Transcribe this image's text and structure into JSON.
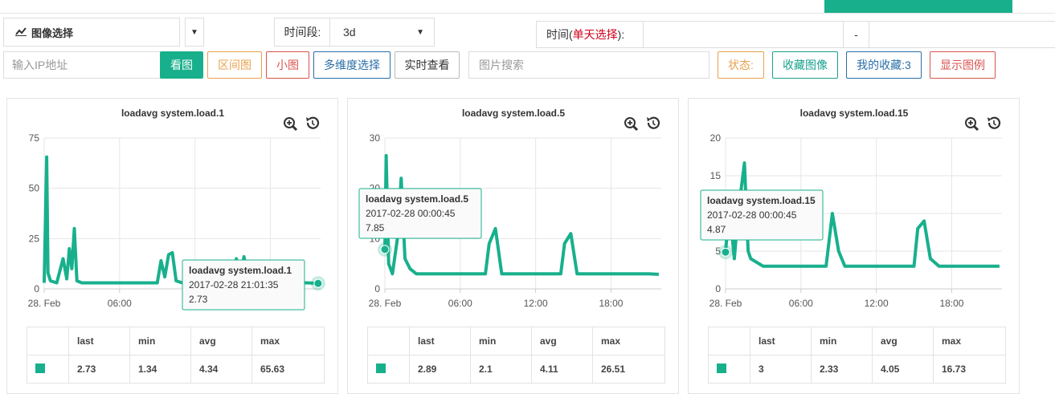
{
  "toolbar": {
    "image_select_label": "图像选择",
    "period_label": "时间段:",
    "period_value": "3d",
    "time_label_prefix": "时间(",
    "time_label_red": "单天选择",
    "time_label_suffix": "):",
    "time_dash": "-",
    "ip_placeholder": "输入IP地址",
    "view_button": "看图",
    "range_button": "区间图",
    "small_button": "小图",
    "multi_button": "多维度选择",
    "realtime_button": "实时查看",
    "pic_search_placeholder": "图片搜索",
    "status_button": "状态:",
    "fav_button": "收藏图像",
    "my_fav_button": "我的收藏:3",
    "legend_button": "显示图例"
  },
  "colors": {
    "accent": "#18b08c",
    "red": "#d0021b"
  },
  "icons": {
    "chart": "line-chart-icon",
    "zoom": "zoom-in-icon",
    "reset": "history-icon"
  },
  "stats_headers": [
    "last",
    "min",
    "avg",
    "max"
  ],
  "charts": [
    {
      "title": "loadavg system.load.1",
      "stats": {
        "last": "2.73",
        "min": "1.34",
        "avg": "4.34",
        "max": "65.63"
      },
      "tooltip": {
        "series": "loadavg system.load.1",
        "time": "2017-02-28 21:01:35",
        "value": "2.73"
      }
    },
    {
      "title": "loadavg system.load.5",
      "stats": {
        "last": "2.89",
        "min": "2.1",
        "avg": "4.11",
        "max": "26.51"
      },
      "tooltip": {
        "series": "loadavg system.load.5",
        "time": "2017-02-28 00:00:45",
        "value": "7.85"
      }
    },
    {
      "title": "loadavg system.load.15",
      "stats": {
        "last": "3",
        "min": "2.33",
        "avg": "4.05",
        "max": "16.73"
      },
      "tooltip": {
        "series": "loadavg system.load.15",
        "time": "2017-02-28 00:00:45",
        "value": "4.87"
      }
    }
  ],
  "chart_data": [
    {
      "type": "line",
      "title": "loadavg system.load.1",
      "x_ticks": [
        "28. Feb",
        "06:00",
        "12:00",
        "18:00"
      ],
      "y_ticks": [
        "0",
        "25",
        "50",
        "75"
      ],
      "ylim": [
        0,
        75
      ],
      "xlim_hours": [
        0,
        22
      ],
      "grid": true,
      "series": [
        {
          "name": "loadavg system.load.1",
          "x_hours": [
            0,
            0.2,
            0.3,
            0.5,
            1,
            1.5,
            1.8,
            2,
            2.2,
            2.4,
            2.6,
            3,
            4,
            5,
            6,
            7,
            8,
            9,
            9.3,
            9.6,
            9.9,
            10.2,
            10.5,
            11,
            12,
            13,
            14,
            15,
            15.3,
            15.6,
            15.9,
            16.3,
            17,
            18,
            19,
            20,
            21,
            21.8
          ],
          "values": [
            3,
            65.6,
            8,
            4,
            3,
            15,
            5,
            20,
            10,
            30,
            4,
            3,
            3,
            3,
            3,
            3,
            3,
            3,
            14,
            6,
            17,
            18,
            4,
            3,
            3,
            3,
            3,
            3,
            15,
            4,
            16,
            4,
            3,
            3,
            4,
            3,
            3,
            2.73
          ]
        }
      ]
    },
    {
      "type": "line",
      "title": "loadavg system.load.5",
      "x_ticks": [
        "28. Feb",
        "06:00",
        "12:00",
        "18:00"
      ],
      "y_ticks": [
        "0",
        "10",
        "20",
        "30"
      ],
      "ylim": [
        0,
        30
      ],
      "xlim_hours": [
        0,
        22
      ],
      "grid": true,
      "series": [
        {
          "name": "loadavg system.load.5",
          "x_hours": [
            0,
            0.1,
            0.3,
            0.6,
            1,
            1.3,
            1.6,
            2,
            2.5,
            3,
            4,
            5,
            6,
            7,
            8,
            8.3,
            8.8,
            9.3,
            10,
            11,
            12,
            13,
            14,
            14.3,
            14.8,
            15.3,
            16,
            17,
            18,
            19,
            20,
            21,
            21.8
          ],
          "values": [
            7.85,
            26.5,
            5,
            3,
            10,
            22,
            6,
            4,
            3,
            3,
            3,
            3,
            3,
            3,
            3,
            9,
            12,
            3,
            3,
            3,
            3,
            3,
            3,
            9,
            11,
            3,
            3,
            3,
            3,
            3,
            3,
            3,
            2.89
          ]
        }
      ]
    },
    {
      "type": "line",
      "title": "loadavg system.load.15",
      "x_ticks": [
        "28. Feb",
        "06:00",
        "12:00",
        "18:00"
      ],
      "y_ticks": [
        "0",
        "5",
        "10",
        "15",
        "20"
      ],
      "ylim": [
        0,
        20
      ],
      "xlim_hours": [
        0,
        22
      ],
      "grid": true,
      "series": [
        {
          "name": "loadavg system.load.15",
          "x_hours": [
            0,
            0.3,
            0.7,
            1,
            1.5,
            1.8,
            2,
            2.5,
            3,
            4,
            5,
            6,
            7,
            8,
            8.5,
            9,
            9.5,
            10,
            11,
            12,
            13,
            14,
            15,
            15.3,
            15.8,
            16.3,
            17,
            18,
            19,
            20,
            21,
            21.8
          ],
          "values": [
            4.87,
            11,
            4,
            10,
            16.7,
            5,
            4,
            3.5,
            3,
            3,
            3,
            3,
            3,
            3,
            10,
            5,
            3,
            3,
            3,
            3,
            3,
            3,
            3,
            8,
            9,
            4,
            3,
            3,
            3,
            3,
            3,
            3
          ]
        }
      ]
    }
  ]
}
